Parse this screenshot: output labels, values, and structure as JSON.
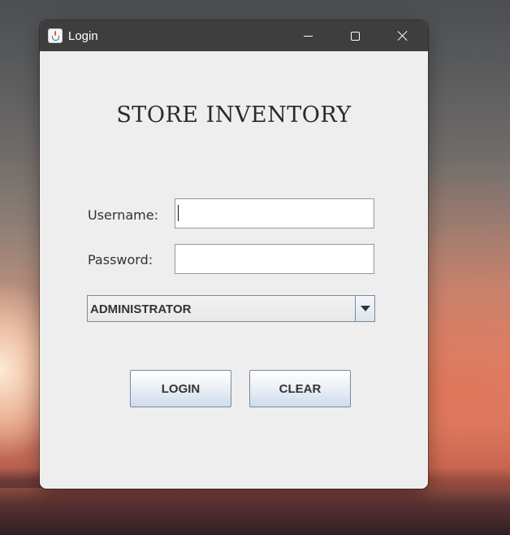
{
  "window": {
    "title": "Login",
    "app_icon": "java-cup-icon",
    "controls": {
      "minimize_icon": "minimize-icon",
      "maximize_icon": "maximize-icon",
      "close_icon": "close-icon"
    }
  },
  "form": {
    "heading": "STORE INVENTORY",
    "username_label": "Username:",
    "username_value": "",
    "password_label": "Password:",
    "password_value": "",
    "role_selected": "ADMINISTRATOR",
    "login_label": "LOGIN",
    "clear_label": "CLEAR"
  },
  "colors": {
    "titlebar": "#3f3e3e",
    "window_bg": "#eeeeee",
    "button_gradient_bottom": "#cfdceb"
  }
}
